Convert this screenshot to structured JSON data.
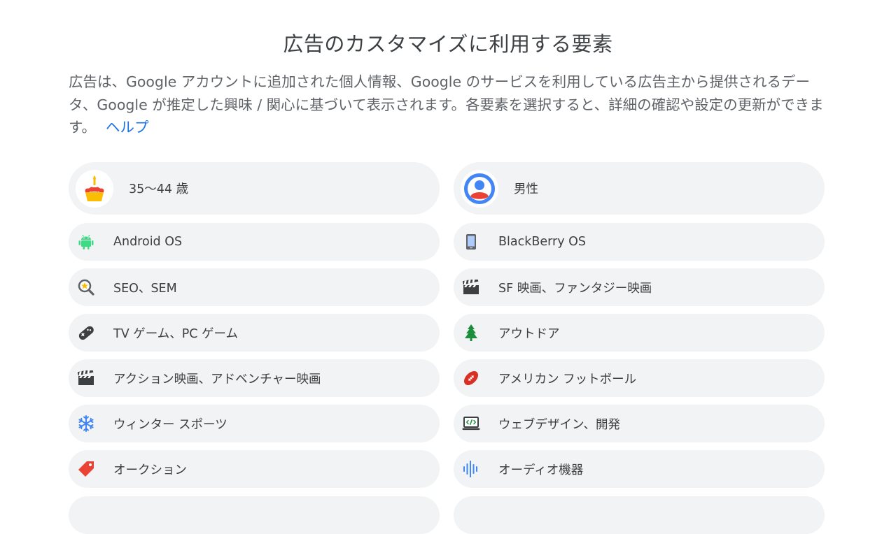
{
  "page": {
    "title": "広告のカスタマイズに利用する要素",
    "description": "広告は、Google アカウントに追加された個人情報、Google のサービスを利用している広告主から提供されるデータ、Google が推定した興味 / 関心に基づいて表示されます。各要素を選択すると、詳細の確認や設定の更新ができます。",
    "help_link": "ヘルプ"
  },
  "factors": [
    {
      "label": "35～44 歳",
      "icon": "birthday-cake-icon"
    },
    {
      "label": "男性",
      "icon": "person-avatar-icon"
    },
    {
      "label": "Android OS",
      "icon": "android-icon"
    },
    {
      "label": "BlackBerry OS",
      "icon": "smartphone-icon"
    },
    {
      "label": "SEO、SEM",
      "icon": "magnifier-icon"
    },
    {
      "label": "SF 映画、ファンタジー映画",
      "icon": "clapperboard-icon"
    },
    {
      "label": "TV ゲーム、PC ゲーム",
      "icon": "gamepad-icon"
    },
    {
      "label": "アウトドア",
      "icon": "pine-tree-icon"
    },
    {
      "label": "アクション映画、アドベンチャー映画",
      "icon": "clapperboard-icon"
    },
    {
      "label": "アメリカン フットボール",
      "icon": "football-icon"
    },
    {
      "label": "ウィンター スポーツ",
      "icon": "snowflake-icon"
    },
    {
      "label": "ウェブデザイン、開発",
      "icon": "code-laptop-icon"
    },
    {
      "label": "オークション",
      "icon": "price-tag-icon"
    },
    {
      "label": "オーディオ機器",
      "icon": "audio-waveform-icon"
    }
  ],
  "colors": {
    "card_bg": "#f1f3f4",
    "link": "#1a73e8",
    "text": "#3c4043",
    "subtext": "#5f6368"
  }
}
